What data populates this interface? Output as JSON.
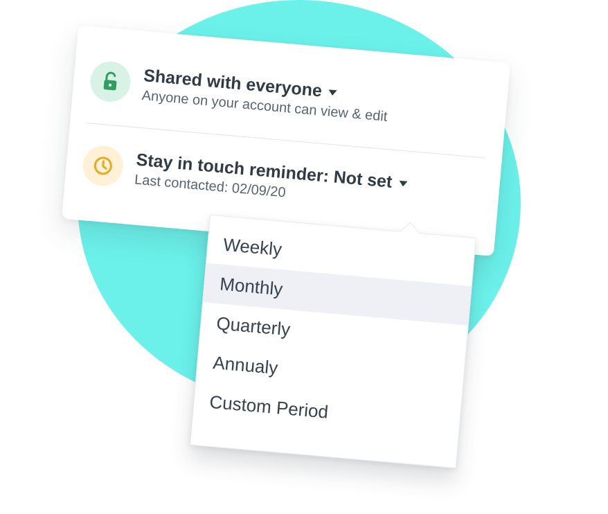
{
  "colors": {
    "background_circle": "#6bf1ea",
    "card": "#ffffff",
    "share_icon_bg": "#d8f3e6",
    "share_icon_fg": "#2f9f5f",
    "reminder_icon_bg": "#fff1d6",
    "reminder_icon_fg": "#e3ac26",
    "selected_row": "#eef0f5",
    "text_primary": "#303b46",
    "text_secondary": "#58636f"
  },
  "sharing": {
    "icon": "lock-open-icon",
    "title": "Shared with everyone",
    "subtitle": "Anyone on your account can view & edit"
  },
  "reminder": {
    "icon": "clock-icon",
    "title": "Stay in touch reminder: Not set",
    "subtitle": "Last contacted: 02/09/20"
  },
  "frequency_menu": {
    "selected": "Monthly",
    "items": [
      "Weekly",
      "Monthly",
      "Quarterly",
      "Annualy",
      "Custom Period"
    ]
  }
}
